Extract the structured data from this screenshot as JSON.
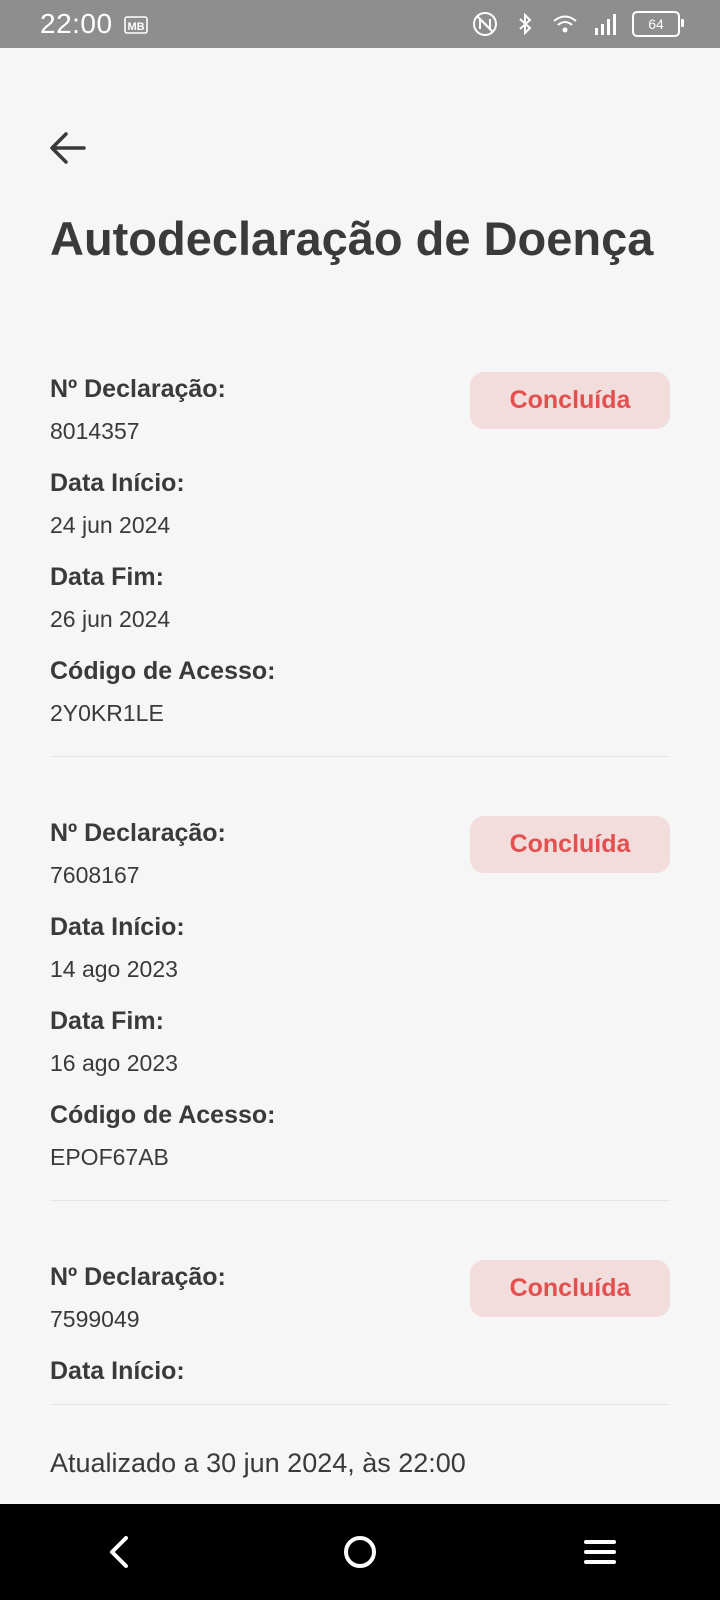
{
  "status_bar": {
    "time": "22:00",
    "carrier_icon": "mb-icon",
    "battery": "64",
    "network": "4G"
  },
  "page": {
    "title": "Autodeclaração de Doença",
    "updated": "Atualizado a 30 jun 2024, às 22:00"
  },
  "labels": {
    "declaration": "Nº Declaração:",
    "start": "Data Início:",
    "end": "Data Fim:",
    "code": "Código de Acesso:"
  },
  "records": [
    {
      "number": "8014357",
      "start": "24 jun 2024",
      "end": "26 jun 2024",
      "code": "2Y0KR1LE",
      "status": "Concluída"
    },
    {
      "number": "7608167",
      "start": "14 ago 2023",
      "end": "16 ago 2023",
      "code": "EPOF67AB",
      "status": "Concluída"
    },
    {
      "number": "7599049",
      "status": "Concluída"
    }
  ],
  "colors": {
    "badge_bg": "#f3dcdc",
    "badge_text": "#e2504f",
    "background": "#f6f6f6"
  }
}
